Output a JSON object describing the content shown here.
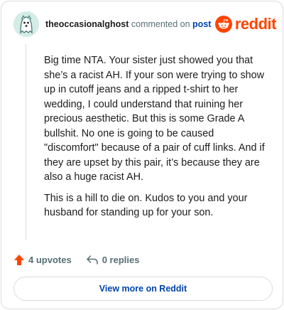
{
  "header": {
    "username": "theoccasionalghost",
    "action_text": "commented on",
    "link_text": "post",
    "brand_name": "reddit",
    "brand_color": "#ff4500"
  },
  "comment": {
    "paragraphs": [
      "Big time NTA. Your sister just showed you that she’s a racist AH. If your son were trying to show up in cutoff jeans and a ripped t-shirt to her wedding, I could understand that ruining her precious aesthetic. But this is some Grade A bullshit. No one is going to be caused \"discomfort\" because of a pair of cuff links. And if they are upset by this pair, it’s because they are also a huge racist AH.",
      "This is a hill to die on. Kudos to you and your husband for standing up for your son."
    ]
  },
  "actions": {
    "upvotes_label": "4 upvotes",
    "replies_label": "0 replies",
    "upvote_icon": "upvote-arrow-icon",
    "reply_icon": "reply-icon"
  },
  "footer": {
    "view_more_label": "View more on Reddit",
    "link_color": "#0045ac"
  }
}
